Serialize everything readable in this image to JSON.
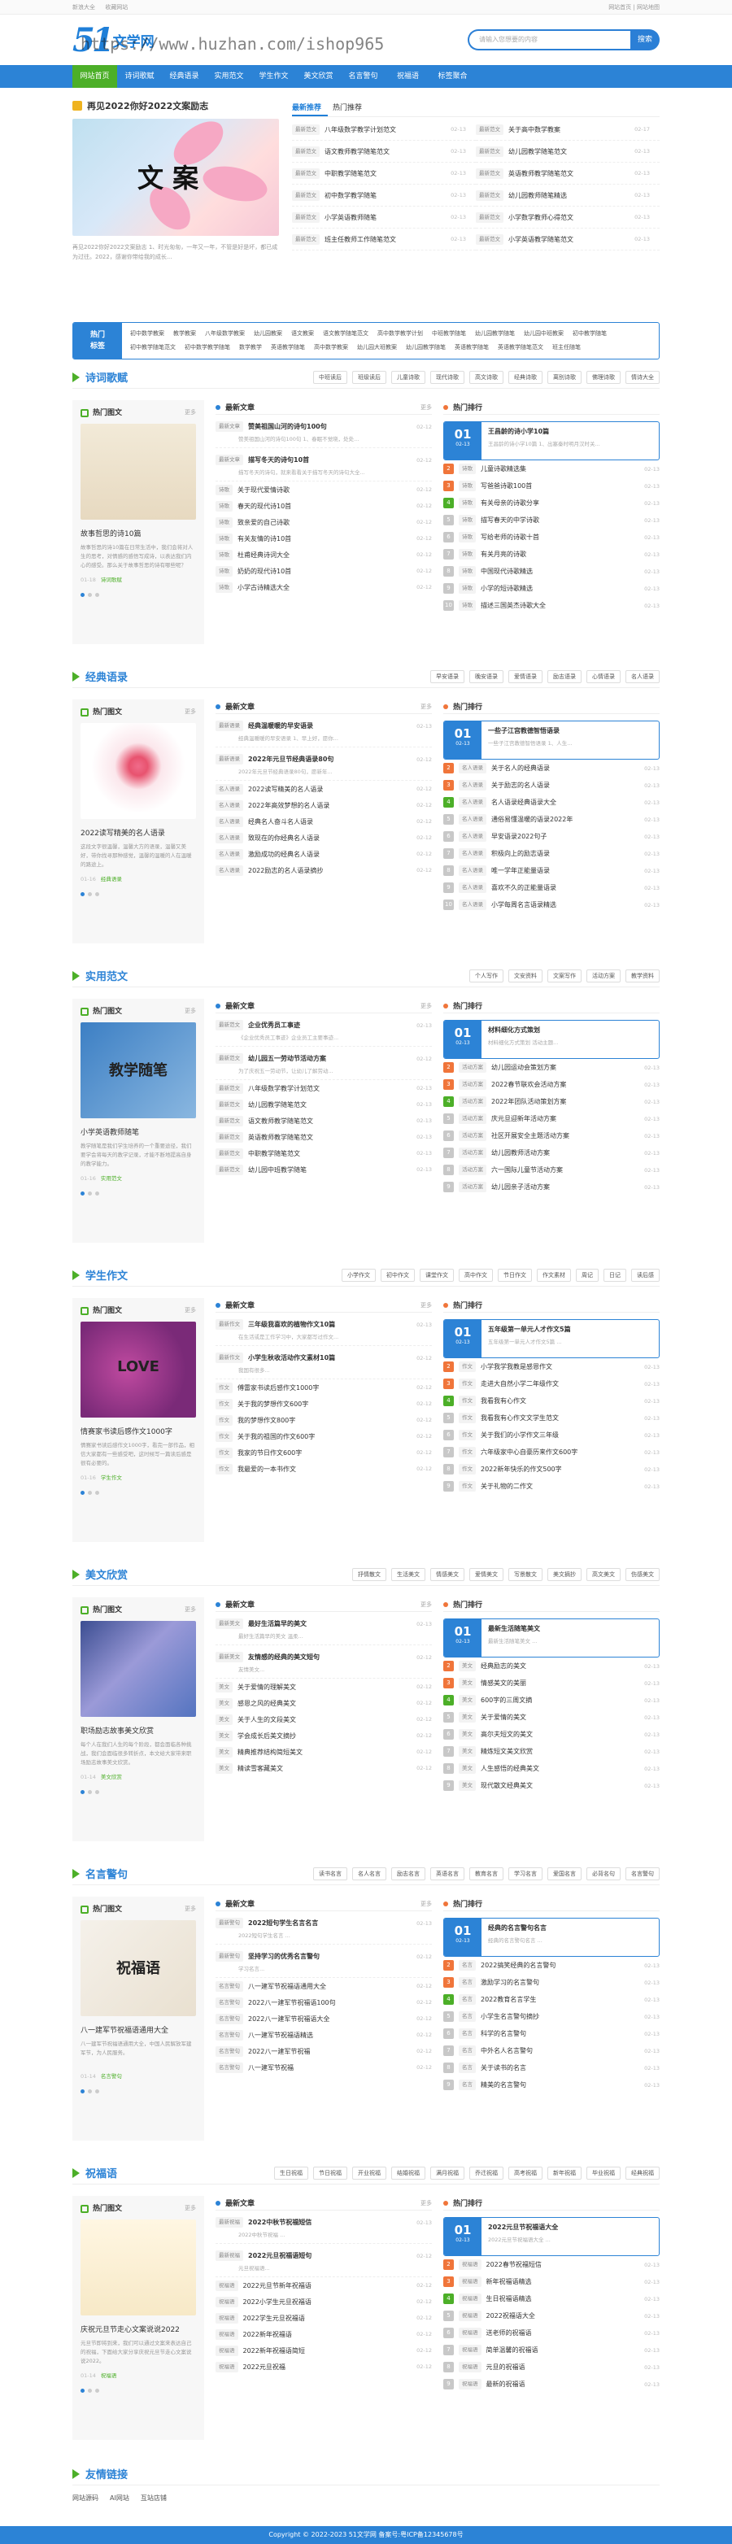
{
  "topbar": {
    "links": [
      "新浪大全",
      "收藏网站"
    ],
    "right": "网站首页 | 网站地图"
  },
  "logo": {
    "num": "51",
    "text": "文学网"
  },
  "watermark": "https://www.huzhan.com/ishop965",
  "search": {
    "placeholder": "请输入您想要的内容",
    "button": "搜索"
  },
  "nav": [
    "网站首页",
    "诗词歌赋",
    "经典语录",
    "实用范文",
    "学生作文",
    "美文欣赏",
    "名言警句",
    "祝福语",
    "标签聚合"
  ],
  "featured": {
    "title": "再见2022你好2022文案励志",
    "image_text": "文 案",
    "desc": "再见2022你好2022文案励志 1、时光匆匆，一年又一年，不管是好是坏，都已成为过往。2022，感谢你带给我的成长..."
  },
  "hot_tabs": [
    "最新推荐",
    "热门推荐"
  ],
  "hot_list": [
    {
      "tag": "最新范文",
      "title": "八年级数学教学计划范文",
      "date": "02-13"
    },
    {
      "tag": "最新范文",
      "title": "关于高中数学教案",
      "date": "02-17"
    },
    {
      "tag": "最新范文",
      "title": "语文教师教学随笔范文",
      "date": "02-13"
    },
    {
      "tag": "最新范文",
      "title": "幼儿园教学随笔范文",
      "date": "02-13"
    },
    {
      "tag": "最新范文",
      "title": "中职教学随笔范文",
      "date": "02-13"
    },
    {
      "tag": "最新范文",
      "title": "英语教师教学随笔范文",
      "date": "02-13"
    },
    {
      "tag": "最新范文",
      "title": "初中数学教学随笔",
      "date": "02-13"
    },
    {
      "tag": "最新范文",
      "title": "幼儿园教师随笔精选",
      "date": "02-13"
    },
    {
      "tag": "最新范文",
      "title": "小学英语教师随笔",
      "date": "02-13"
    },
    {
      "tag": "最新范文",
      "title": "小学数学教师心得范文",
      "date": "02-13"
    },
    {
      "tag": "最新范文",
      "title": "班主任教师工作随笔范文",
      "date": "02-13"
    },
    {
      "tag": "最新范文",
      "title": "小学英语教学随笔范文",
      "date": "02-13"
    }
  ],
  "catbar": {
    "label": "热门\n标签",
    "links": [
      "初中数学教案",
      "教学教案",
      "八年级数学教案",
      "幼儿园教案",
      "语文教案",
      "语文教学随笔范文",
      "高中数学教学计划",
      "中班教学随笔",
      "幼儿园教学随笔",
      "幼儿园中班教案",
      "初中教学随笔",
      "初中教学随笔范文",
      "初中数学教学随笔",
      "数学教学",
      "英语教学随笔",
      "高中数学教案",
      "幼儿园大班教案",
      "幼儿园教学随笔",
      "英语教学随笔",
      "英语教学随笔范文",
      "班主任随笔"
    ]
  },
  "sections": [
    {
      "title": "诗词歌赋",
      "tags": [
        "中班读后",
        "班级读后",
        "儿童诗歌",
        "现代诗歌",
        "高文诗歌",
        "经典诗歌",
        "离别诗歌",
        "佛理诗歌",
        "情诗大全"
      ],
      "pic": {
        "more": "更多",
        "title": "故事哲思的诗10篇",
        "desc": "故事哲思的诗10篇在日常生活中，我们会将对人生的思考，对情感的感悟写成诗，以表达我们内心的感受。那么关于故事哲思的诗有哪些呢？",
        "date": "01-18",
        "cat": "诗词歌赋"
      },
      "news": [
        {
          "tag": "最新文章",
          "title": "赞美祖国山河的诗句100句",
          "date": "02-12",
          "desc": "赞美祖国山河的诗句100句 1、春眠不觉晓，处处..."
        },
        {
          "tag": "最新文章",
          "title": "描写冬天的诗句10首",
          "date": "02-12",
          "desc": "描写冬天的诗句，就来看看关于描写冬天的诗句大全..."
        }
      ],
      "nlist": [
        {
          "tag": "诗歌",
          "title": "关于现代爱情诗歌",
          "date": "02-12"
        },
        {
          "tag": "诗歌",
          "title": "春天的现代诗10首",
          "date": "02-12"
        },
        {
          "tag": "诗歌",
          "title": "致亲爱的自己诗歌",
          "date": "02-12"
        },
        {
          "tag": "诗歌",
          "title": "有关友情的诗10首",
          "date": "02-12"
        },
        {
          "tag": "诗歌",
          "title": "杜甫经典诗词大全",
          "date": "02-12"
        },
        {
          "tag": "诗歌",
          "title": "奶奶的现代诗10首",
          "date": "02-12"
        },
        {
          "tag": "诗歌",
          "title": "小学古诗精选大全",
          "date": "02-12"
        }
      ],
      "rtop": {
        "num": "01",
        "dd": "02-13",
        "title": "王昌龄的诗小学10篇",
        "desc": "王昌龄的诗小学10篇 1、出塞秦时明月汉时关..."
      },
      "rlist": [
        {
          "tag": "诗歌",
          "title": "儿童诗歌精选集",
          "date": "02-13"
        },
        {
          "tag": "诗歌",
          "title": "写爸爸诗歌100首",
          "date": "02-13"
        },
        {
          "tag": "诗歌",
          "title": "有关母亲的诗歌分享",
          "date": "02-13"
        },
        {
          "tag": "诗歌",
          "title": "描写春天的中学诗歌",
          "date": "02-13"
        },
        {
          "tag": "诗歌",
          "title": "写给老师的诗歌十首",
          "date": "02-13"
        },
        {
          "tag": "诗歌",
          "title": "有关月亮的诗歌",
          "date": "02-13"
        },
        {
          "tag": "诗歌",
          "title": "中国现代诗歌精选",
          "date": "02-13"
        },
        {
          "tag": "诗歌",
          "title": "小学的短诗歌精选",
          "date": "02-13"
        },
        {
          "tag": "诗歌",
          "title": "描述三国英杰诗歌大全",
          "date": "02-13"
        }
      ]
    },
    {
      "title": "经典语录",
      "tags": [
        "早安语录",
        "晚安语录",
        "爱情语录",
        "励志语录",
        "心情语录",
        "名人语录"
      ],
      "pic": {
        "more": "更多",
        "title": "2022读写精美的名人语录",
        "desc": "这段文字很温馨，温馨大方的语录，温馨又美好，带你找寻那种感觉，温馨的温暖的人在温暖的路途上。",
        "date": "01-16",
        "cat": "经典语录"
      },
      "news": [
        {
          "tag": "最新语录",
          "title": "经典温暖暖的早安语录",
          "date": "02-13",
          "desc": "经典温暖暖的早安语录 1、早上好，愿你..."
        },
        {
          "tag": "最新语录",
          "title": "2022年元旦节经典语录80句",
          "date": "02-12",
          "desc": "2022年元旦节经典语录80句，愿新年..."
        }
      ],
      "nlist": [
        {
          "tag": "名人语录",
          "title": "2022读写精美的名人语录",
          "date": "02-12"
        },
        {
          "tag": "名人语录",
          "title": "2022年高效梦想的名人语录",
          "date": "02-12"
        },
        {
          "tag": "名人语录",
          "title": "经典名人奋斗名人语录",
          "date": "02-12"
        },
        {
          "tag": "名人语录",
          "title": "致现在的你经典名人语录",
          "date": "02-12"
        },
        {
          "tag": "名人语录",
          "title": "激励成功的经典名人语录",
          "date": "02-12"
        },
        {
          "tag": "名人语录",
          "title": "2022励志的名人语录摘抄",
          "date": "02-12"
        }
      ],
      "rtop": {
        "num": "01",
        "dd": "02-13",
        "title": "一些子江宫教德智悟语录",
        "desc": "一些子江宫教德智悟语录 1、人生..."
      },
      "rlist": [
        {
          "tag": "名人语录",
          "title": "关于名人的经典语录",
          "date": "02-13"
        },
        {
          "tag": "名人语录",
          "title": "关于励志的名人语录",
          "date": "02-13"
        },
        {
          "tag": "名人语录",
          "title": "名人语录经典语录大全",
          "date": "02-13"
        },
        {
          "tag": "名人语录",
          "title": "通俗易懂温暖的语录2022年",
          "date": "02-13"
        },
        {
          "tag": "名人语录",
          "title": "早安语录2022句子",
          "date": "02-13"
        },
        {
          "tag": "名人语录",
          "title": "积极向上的励志语录",
          "date": "02-13"
        },
        {
          "tag": "名人语录",
          "title": "唯一学年正能量语录",
          "date": "02-13"
        },
        {
          "tag": "名人语录",
          "title": "喜欢不久的正能量语录",
          "date": "02-13"
        },
        {
          "tag": "名人语录",
          "title": "小学每周名言语录精选",
          "date": "02-13"
        }
      ]
    },
    {
      "title": "实用范文",
      "tags": [
        "个人写作",
        "文安资料",
        "文案写作",
        "活动方案",
        "教学资料"
      ],
      "pic": {
        "more": "更多",
        "title": "小学英语教师随笔",
        "desc": "教学随笔是我们学生培养的一个重要途径，我们要学会将每天的教学记录，才能不断地提高自身的教学能力。",
        "date": "01-16",
        "cat": "实用范文"
      },
      "news": [
        {
          "tag": "最新范文",
          "title": "企业优秀员工事迹",
          "date": "02-13",
          "desc": "《企业优秀员工事迹》企业员工主要事迹..."
        },
        {
          "tag": "最新范文",
          "title": "幼儿园五一劳动节活动方案",
          "date": "02-12",
          "desc": "为了庆祝五一劳动节，让幼儿了解劳动..."
        }
      ],
      "nlist": [
        {
          "tag": "最新范文",
          "title": "八年级数学教学计划范文",
          "date": "02-13"
        },
        {
          "tag": "最新范文",
          "title": "幼儿园教学随笔范文",
          "date": "02-13"
        },
        {
          "tag": "最新范文",
          "title": "语文教师教学随笔范文",
          "date": "02-13"
        },
        {
          "tag": "最新范文",
          "title": "英语教师教学随笔范文",
          "date": "02-13"
        },
        {
          "tag": "最新范文",
          "title": "中职教学随笔范文",
          "date": "02-13"
        },
        {
          "tag": "最新范文",
          "title": "幼儿园中班教学随笔",
          "date": "02-13"
        }
      ],
      "rtop": {
        "num": "01",
        "dd": "02-13",
        "title": "材料细化方式策划",
        "desc": "材料细化方式策划 活动主题..."
      },
      "rlist": [
        {
          "tag": "活动方案",
          "title": "幼儿园运动会策划方案",
          "date": "02-13"
        },
        {
          "tag": "活动方案",
          "title": "2022春节联欢会活动方案",
          "date": "02-13"
        },
        {
          "tag": "活动方案",
          "title": "2022年团队活动策划方案",
          "date": "02-13"
        },
        {
          "tag": "活动方案",
          "title": "庆元旦迎新年活动方案",
          "date": "02-13"
        },
        {
          "tag": "活动方案",
          "title": "社区开展安全主题活动方案",
          "date": "02-13"
        },
        {
          "tag": "活动方案",
          "title": "幼儿园教师活动方案",
          "date": "02-13"
        },
        {
          "tag": "活动方案",
          "title": "六一国际儿童节活动方案",
          "date": "02-13"
        },
        {
          "tag": "活动方案",
          "title": "幼儿园亲子活动方案",
          "date": "02-13"
        }
      ]
    },
    {
      "title": "学生作文",
      "tags": [
        "小学作文",
        "初中作文",
        "课堂作文",
        "高中作文",
        "节日作文",
        "作文素材",
        "周记",
        "日记",
        "读后感"
      ],
      "pic": {
        "more": "更多",
        "title": "情赛家书读后感作文1000字",
        "desc": "情赛家书读后感作文1000字，看完一部作品，相信大家都有一些感受吧，这时候写一篇读后感是很有必要的。",
        "date": "01-16",
        "cat": "学生作文"
      },
      "news": [
        {
          "tag": "最新作文",
          "title": "三年级我喜欢的植物作文10篇",
          "date": "02-13",
          "desc": "在生活或是工作学习中，大家都写过作文..."
        },
        {
          "tag": "最新作文",
          "title": "小学生秋收活动作文素材10篇",
          "date": "02-12",
          "desc": "我国有很多..."
        }
      ],
      "nlist": [
        {
          "tag": "作文",
          "title": "傅雷家书读后感作文1000字",
          "date": "02-12"
        },
        {
          "tag": "作文",
          "title": "关于我的梦想作文600字",
          "date": "02-12"
        },
        {
          "tag": "作文",
          "title": "我的梦想作文800字",
          "date": "02-12"
        },
        {
          "tag": "作文",
          "title": "关于我的祖国的作文600字",
          "date": "02-12"
        },
        {
          "tag": "作文",
          "title": "我家的节日作文600字",
          "date": "02-12"
        },
        {
          "tag": "作文",
          "title": "我最爱的一本书作文",
          "date": "02-12"
        }
      ],
      "rtop": {
        "num": "01",
        "dd": "02-13",
        "title": "五年级第一单元人才作文5篇",
        "desc": "五年级第一单元人才作文5篇 ..."
      },
      "rlist": [
        {
          "tag": "作文",
          "title": "小学我学我教是感恩作文",
          "date": "02-13"
        },
        {
          "tag": "作文",
          "title": "走进大自然小学二年级作文",
          "date": "02-13"
        },
        {
          "tag": "作文",
          "title": "我看我有心作文",
          "date": "02-13"
        },
        {
          "tag": "作文",
          "title": "我看我有心作文文学生范文",
          "date": "02-13"
        },
        {
          "tag": "作文",
          "title": "关于我们的小学作文三年级",
          "date": "02-13"
        },
        {
          "tag": "作文",
          "title": "六年级家中心自豪历来作文600字",
          "date": "02-13"
        },
        {
          "tag": "作文",
          "title": "2022新年快乐的作文500字",
          "date": "02-13"
        },
        {
          "tag": "作文",
          "title": "关于礼物的二作文",
          "date": "02-13"
        }
      ]
    },
    {
      "title": "美文欣赏",
      "tags": [
        "抒情散文",
        "生活美文",
        "情感美文",
        "爱情美文",
        "写景散文",
        "美文摘抄",
        "高文美文",
        "伤感美文"
      ],
      "pic": {
        "more": "更多",
        "title": "职场励志故事美文欣赏",
        "desc": "每个人在我们人生的每个阶段，都会面临各种挑战，我们会面临很多转折点，本文给大家带来职场励志故事美文欣赏。",
        "date": "01-14",
        "cat": "美文欣赏"
      },
      "news": [
        {
          "tag": "最新美文",
          "title": "最好生活篇早的美文",
          "date": "02-13",
          "desc": "最好生活篇早的美文 温柔..."
        },
        {
          "tag": "最新美文",
          "title": "友情感的经典的美文短句",
          "date": "02-12",
          "desc": "友情美文..."
        }
      ],
      "nlist": [
        {
          "tag": "美文",
          "title": "关于爱情的理解美文",
          "date": "02-12"
        },
        {
          "tag": "美文",
          "title": "感恩之风的经典美文",
          "date": "02-12"
        },
        {
          "tag": "美文",
          "title": "关于人生的文段美文",
          "date": "02-12"
        },
        {
          "tag": "美文",
          "title": "学会成长后美文摘抄",
          "date": "02-12"
        },
        {
          "tag": "美文",
          "title": "精典推荐结构简短美文",
          "date": "02-12"
        },
        {
          "tag": "美文",
          "title": "精读雪客藏美文",
          "date": "02-12"
        }
      ],
      "rtop": {
        "num": "01",
        "dd": "02-13",
        "title": "最新生活随笔美文",
        "desc": "最新生活随笔美文 ..."
      },
      "rlist": [
        {
          "tag": "美文",
          "title": "经典励志的美文",
          "date": "02-13"
        },
        {
          "tag": "美文",
          "title": "情感美文的美丽",
          "date": "02-13"
        },
        {
          "tag": "美文",
          "title": "600字的三周文摘",
          "date": "02-13"
        },
        {
          "tag": "美文",
          "title": "关于爱情的美文",
          "date": "02-13"
        },
        {
          "tag": "美文",
          "title": "高尔夫短文的美文",
          "date": "02-13"
        },
        {
          "tag": "美文",
          "title": "精炼短文美文欣赏",
          "date": "02-13"
        },
        {
          "tag": "美文",
          "title": "人生感悟的经典美文",
          "date": "02-13"
        },
        {
          "tag": "美文",
          "title": "现代散文经典美文",
          "date": "02-13"
        }
      ]
    },
    {
      "title": "名言警句",
      "tags": [
        "读书名言",
        "名人名言",
        "励志名言",
        "英语名言",
        "教育名言",
        "学习名言",
        "爱国名言",
        "必背名句",
        "名言警句"
      ],
      "pic": {
        "more": "更多",
        "title": "八一建军节祝福语通用大全",
        "desc": "八一建军节祝福语通用大全，中国人民解放军建军节，为人民服务。",
        "date": "01-14",
        "cat": "名言警句"
      },
      "news": [
        {
          "tag": "最新警句",
          "title": "2022短句学生名言名言",
          "date": "02-13",
          "desc": "2022短句学生名言 ..."
        },
        {
          "tag": "最新警句",
          "title": "坚持学习的优秀名言警句",
          "date": "02-12",
          "desc": "学习名言..."
        }
      ],
      "nlist": [
        {
          "tag": "名言警句",
          "title": "八一建军节祝福语通用大全",
          "date": "02-12"
        },
        {
          "tag": "名言警句",
          "title": "2022八一建军节祝福语100句",
          "date": "02-12"
        },
        {
          "tag": "名言警句",
          "title": "2022八一建军节祝福语大全",
          "date": "02-12"
        },
        {
          "tag": "名言警句",
          "title": "八一建军节祝福语精选",
          "date": "02-12"
        },
        {
          "tag": "名言警句",
          "title": "2022八一建军节祝福",
          "date": "02-12"
        },
        {
          "tag": "名言警句",
          "title": "八一建军节祝福",
          "date": "02-12"
        }
      ],
      "rtop": {
        "num": "01",
        "dd": "02-13",
        "title": "经典的名言警句名言",
        "desc": "经典的名言警句名言 ..."
      },
      "rlist": [
        {
          "tag": "名言",
          "title": "2022搞笑经典的名言警句",
          "date": "02-13"
        },
        {
          "tag": "名言",
          "title": "激励学习的名言警句",
          "date": "02-13"
        },
        {
          "tag": "名言",
          "title": "2022教育名言学生",
          "date": "02-13"
        },
        {
          "tag": "名言",
          "title": "小学生名言警句摘抄",
          "date": "02-13"
        },
        {
          "tag": "名言",
          "title": "科学的名言警句",
          "date": "02-13"
        },
        {
          "tag": "名言",
          "title": "中外名人名言警句",
          "date": "02-13"
        },
        {
          "tag": "名言",
          "title": "关于读书的名言",
          "date": "02-13"
        },
        {
          "tag": "名言",
          "title": "精美的名言警句",
          "date": "02-13"
        }
      ]
    },
    {
      "title": "祝福语",
      "tags": [
        "生日祝福",
        "节日祝福",
        "开业祝福",
        "结婚祝福",
        "满月祝福",
        "乔迁祝福",
        "高考祝福",
        "新年祝福",
        "毕业祝福",
        "经典祝福"
      ],
      "pic": {
        "more": "更多",
        "title": "庆祝元旦节走心文案说说2022",
        "desc": "元旦节即将到来，我们可以通过文案来表达自己的祝福，下面给大家分享庆祝元旦节走心文案说说2022。",
        "date": "01-14",
        "cat": "祝福语"
      },
      "news": [
        {
          "tag": "最新祝福",
          "title": "2022中秋节祝福短信",
          "date": "02-13",
          "desc": "2022中秋节祝福 ..."
        },
        {
          "tag": "最新祝福",
          "title": "2022元旦祝福语短句",
          "date": "02-12",
          "desc": "元旦祝福语..."
        }
      ],
      "nlist": [
        {
          "tag": "祝福语",
          "title": "2022元旦节新年祝福语",
          "date": "02-12"
        },
        {
          "tag": "祝福语",
          "title": "2022小学生元旦祝福语",
          "date": "02-12"
        },
        {
          "tag": "祝福语",
          "title": "2022学生元旦祝福语",
          "date": "02-12"
        },
        {
          "tag": "祝福语",
          "title": "2022新年祝福语",
          "date": "02-12"
        },
        {
          "tag": "祝福语",
          "title": "2022新年祝福语简短",
          "date": "02-12"
        },
        {
          "tag": "祝福语",
          "title": "2022元旦祝福",
          "date": "02-12"
        }
      ],
      "rtop": {
        "num": "01",
        "dd": "02-13",
        "title": "2022元旦节祝福语大全",
        "desc": "2022元旦节祝福语大全 ..."
      },
      "rlist": [
        {
          "tag": "祝福语",
          "title": "2022春节祝福短信",
          "date": "02-13"
        },
        {
          "tag": "祝福语",
          "title": "新年祝福语精选",
          "date": "02-13"
        },
        {
          "tag": "祝福语",
          "title": "生日祝福语精选",
          "date": "02-13"
        },
        {
          "tag": "祝福语",
          "title": "2022祝福语大全",
          "date": "02-13"
        },
        {
          "tag": "祝福语",
          "title": "送老师的祝福语",
          "date": "02-13"
        },
        {
          "tag": "祝福语",
          "title": "简单温馨的祝福语",
          "date": "02-13"
        },
        {
          "tag": "祝福语",
          "title": "元旦的祝福语",
          "date": "02-13"
        },
        {
          "tag": "祝福语",
          "title": "最新的祝福语",
          "date": "02-13"
        }
      ]
    }
  ],
  "friends": {
    "title": "友情链接",
    "links": [
      "网站源码",
      "AI网站",
      "互站店铺"
    ]
  },
  "footer": "Copyright © 2022-2023 51文学网 备案号:粤ICP备12345678号"
}
